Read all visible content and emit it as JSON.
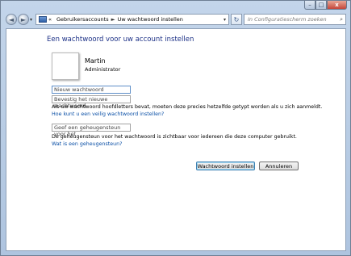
{
  "window": {
    "min_label": "–",
    "max_label": "□",
    "close_label": "x"
  },
  "nav": {
    "back_icon": "◄",
    "forward_icon": "►",
    "dropdown_icon": "▾"
  },
  "address": {
    "separator_start": "«",
    "crumb1": "Gebruikersaccounts",
    "separator": "►",
    "crumb2": "Uw wachtwoord instellen",
    "dropdown_icon": "▾",
    "refresh_icon": "↻"
  },
  "search": {
    "placeholder": "In Configuratiescherm zoeken",
    "icon": "⌕"
  },
  "main": {
    "heading": "Een wachtwoord voor uw account instellen",
    "user_name": "Martin",
    "user_role": "Administrator",
    "new_password_placeholder": "Nieuw wachtwoord",
    "confirm_password_placeholder": "Bevestig het nieuwe wachtwoord",
    "caps_note": "Als uw wachtwoord hoofdletters bevat, moeten deze precies hetzelfde getypt worden als u zich aanmeldt.",
    "strong_password_link": "Hoe kunt u een veilig wachtwoord instellen?",
    "hint_placeholder": "Geef een geheugensteun voor het",
    "hint_note": "De geheugensteun voor het wachtwoord is zichtbaar voor iedereen die deze computer gebruikt.",
    "hint_link": "Wat is een geheugensteun?"
  },
  "buttons": {
    "set_password": "Wachtwoord instellen",
    "cancel": "Annuleren"
  }
}
